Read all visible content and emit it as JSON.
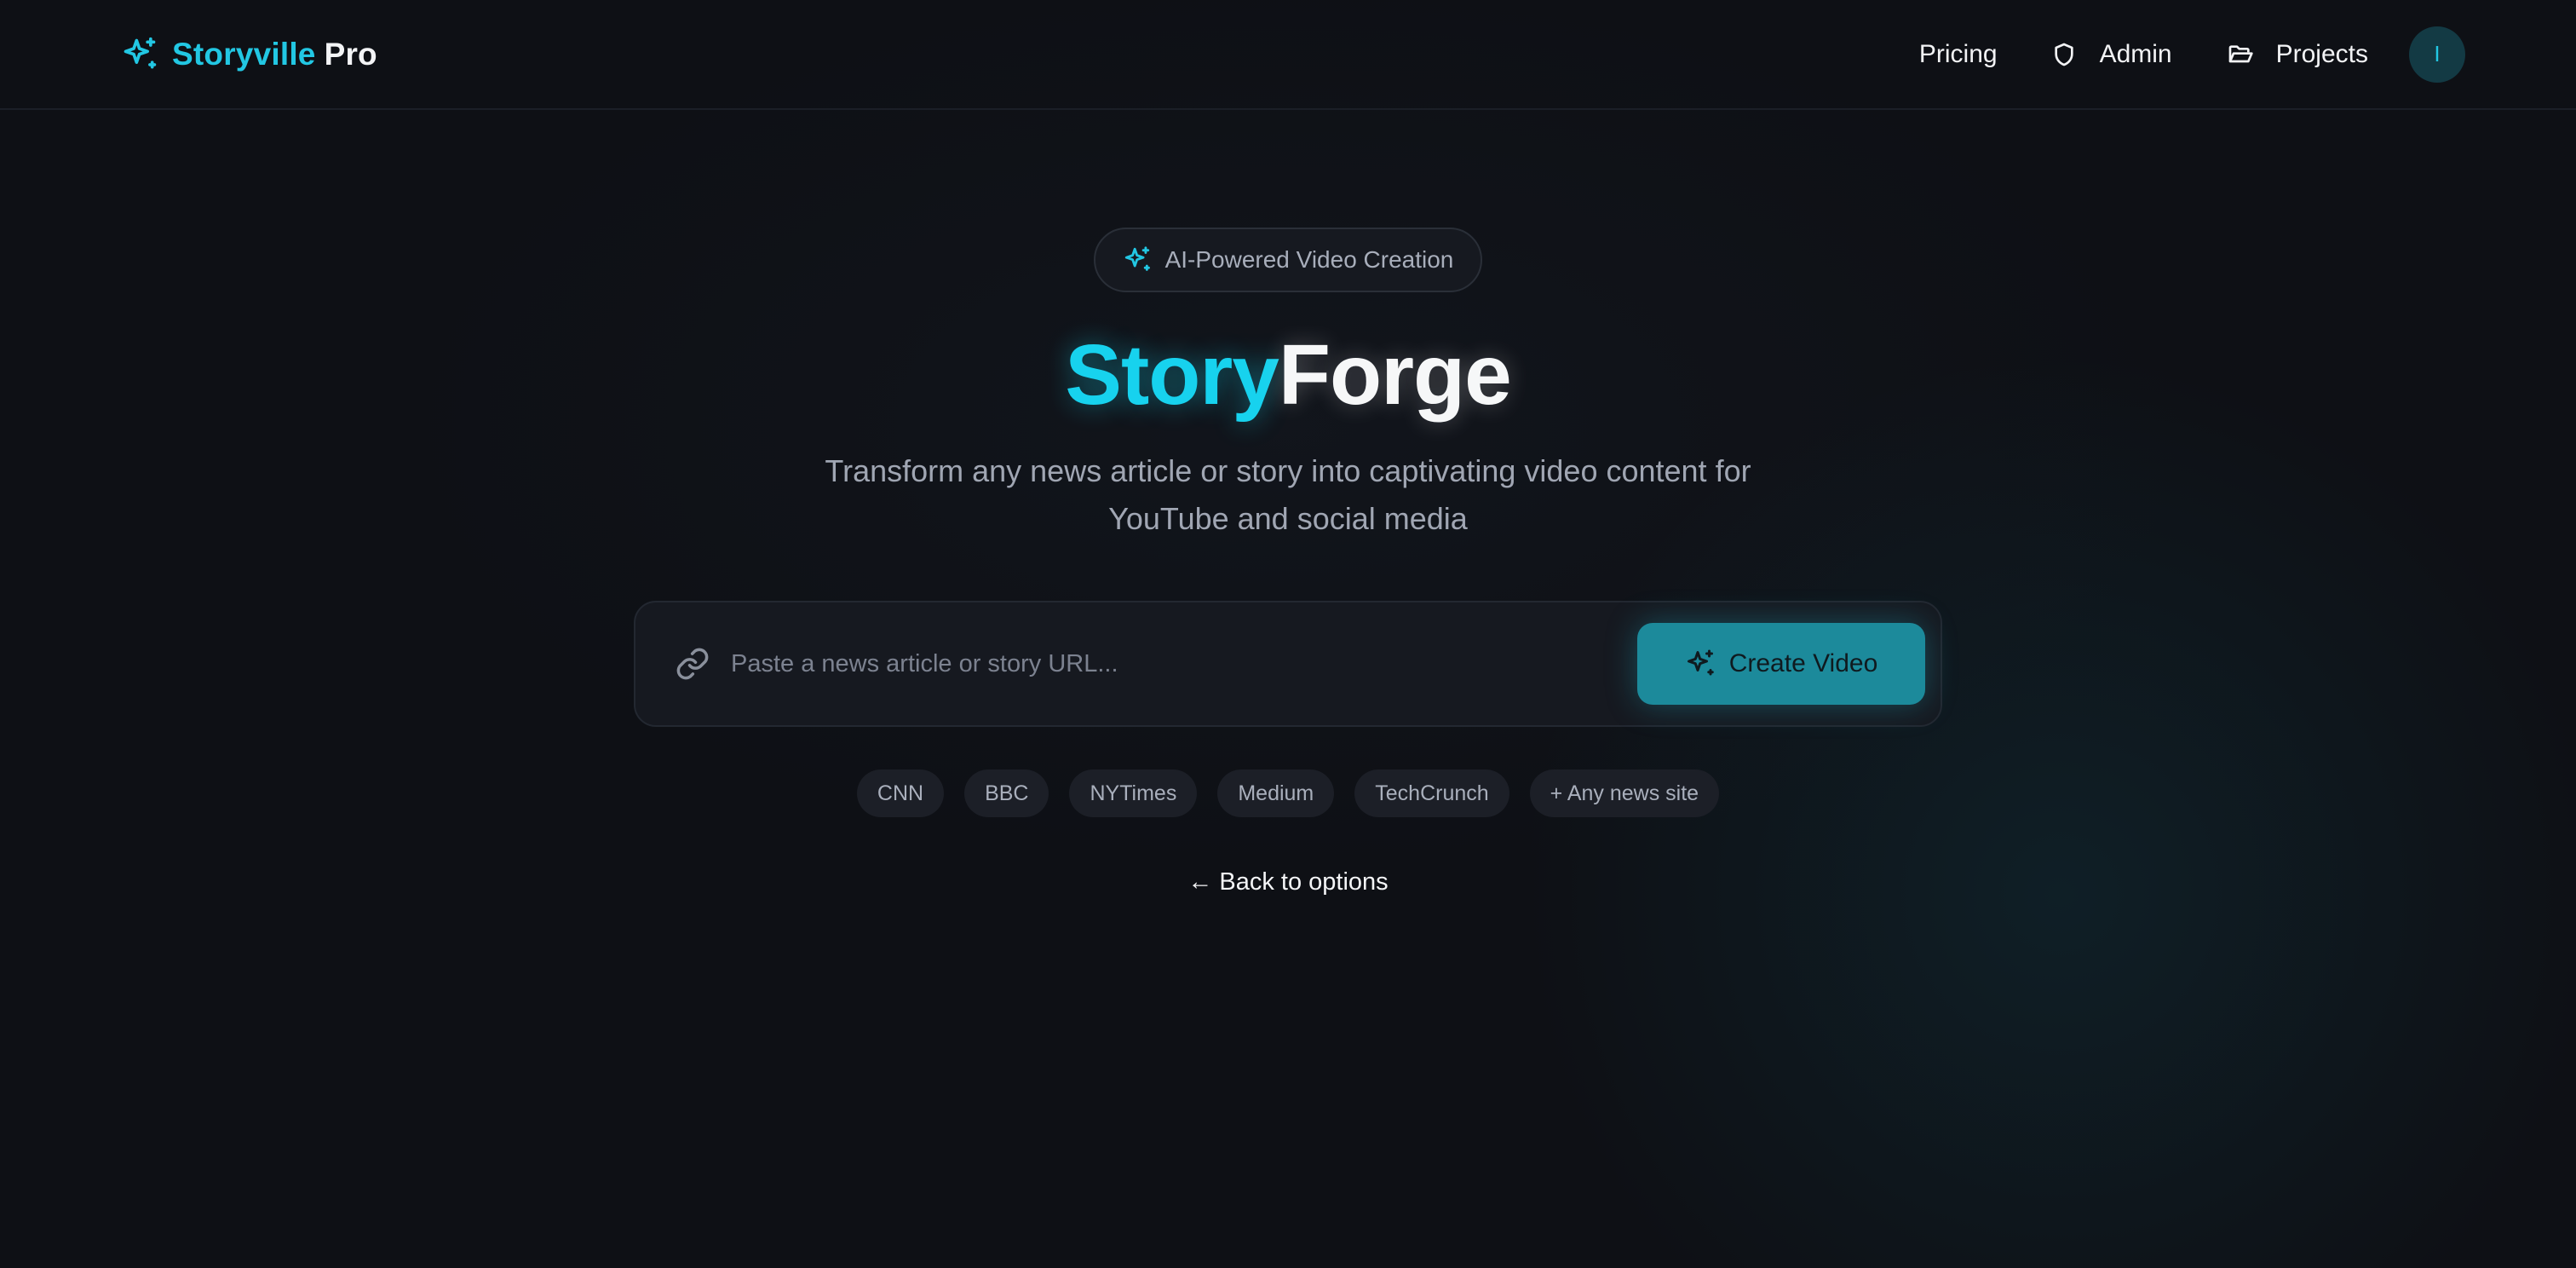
{
  "header": {
    "brand_name": "Storyville",
    "brand_suffix": "Pro",
    "brand_icon": "sparkles-icon",
    "nav": {
      "pricing": "Pricing",
      "admin": "Admin",
      "projects": "Projects"
    },
    "avatar_initial": "I"
  },
  "hero": {
    "badge": "AI-Powered Video Creation",
    "title_part1": "Story",
    "title_part2": "Forge",
    "subtitle_line1": "Transform any news article or story into captivating video content for",
    "subtitle_line2": "YouTube and social media"
  },
  "search": {
    "placeholder": "Paste a news article or story URL...",
    "value": "",
    "button_label": "Create Video"
  },
  "sources": [
    "CNN",
    "BBC",
    "NYTimes",
    "Medium",
    "TechCrunch",
    "+ Any news site"
  ],
  "back_link": "← Back to options",
  "colors": {
    "accent": "#22c7e3",
    "button": "#1c8a9b",
    "background": "#0e1015"
  }
}
